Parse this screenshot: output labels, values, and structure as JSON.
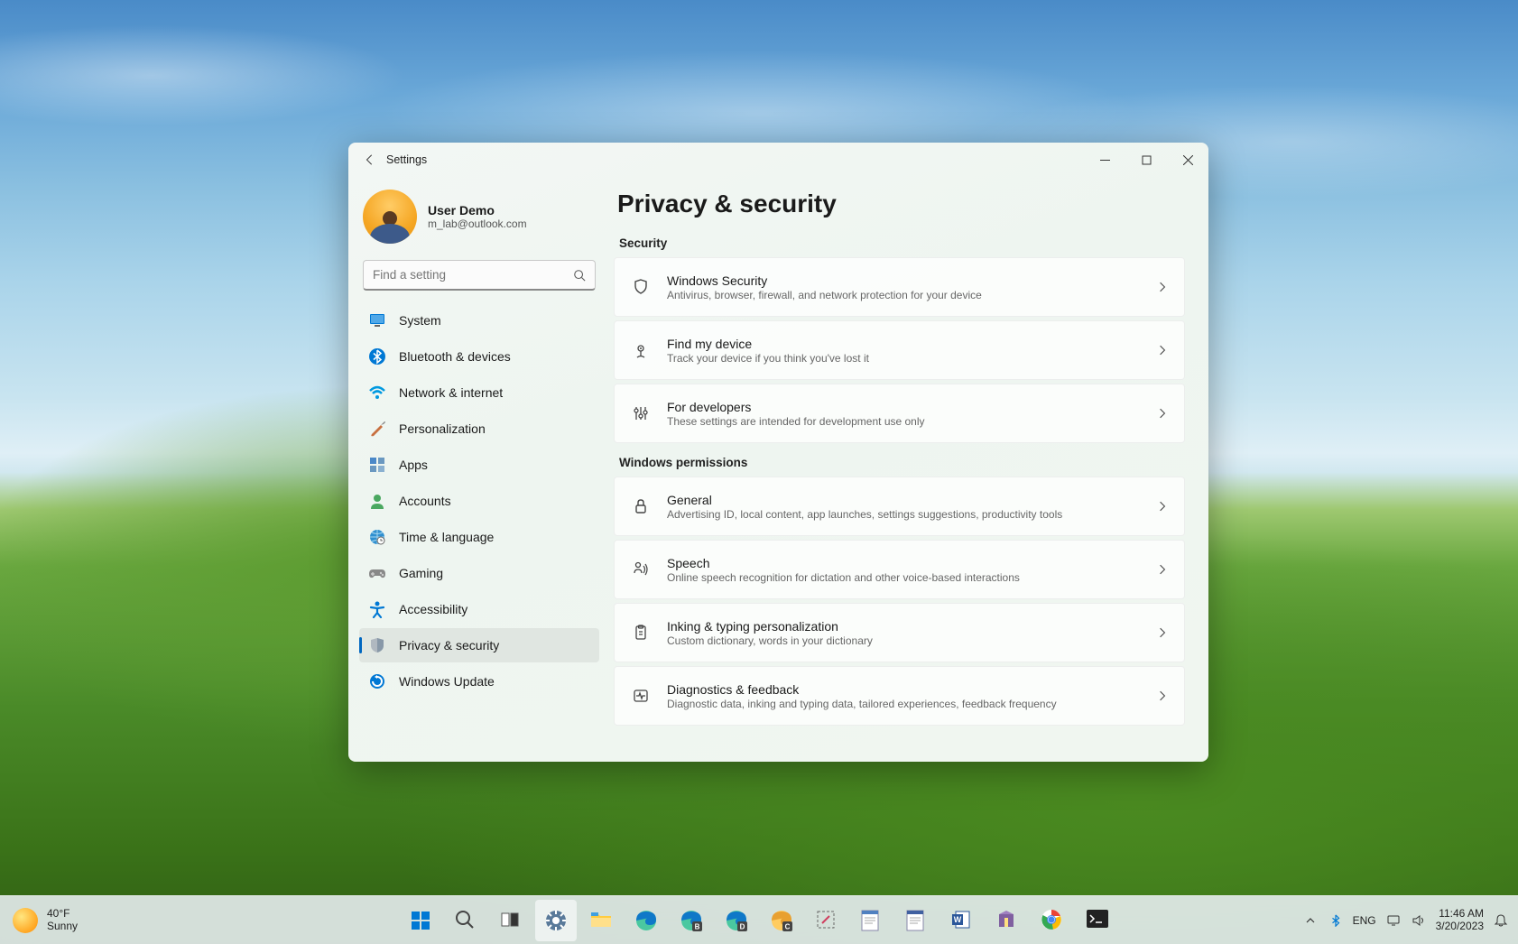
{
  "window": {
    "title": "Settings",
    "user": {
      "name": "User Demo",
      "email": "m_lab@outlook.com"
    },
    "search": {
      "placeholder": "Find a setting"
    }
  },
  "sidebar": {
    "items": [
      {
        "label": "System",
        "selected": false,
        "icon": "system"
      },
      {
        "label": "Bluetooth & devices",
        "selected": false,
        "icon": "bluetooth"
      },
      {
        "label": "Network & internet",
        "selected": false,
        "icon": "wifi"
      },
      {
        "label": "Personalization",
        "selected": false,
        "icon": "brush"
      },
      {
        "label": "Apps",
        "selected": false,
        "icon": "apps"
      },
      {
        "label": "Accounts",
        "selected": false,
        "icon": "person"
      },
      {
        "label": "Time & language",
        "selected": false,
        "icon": "globe"
      },
      {
        "label": "Gaming",
        "selected": false,
        "icon": "gamepad"
      },
      {
        "label": "Accessibility",
        "selected": false,
        "icon": "accessibility"
      },
      {
        "label": "Privacy & security",
        "selected": true,
        "icon": "shield"
      },
      {
        "label": "Windows Update",
        "selected": false,
        "icon": "update"
      }
    ]
  },
  "main": {
    "title": "Privacy & security",
    "sections": [
      {
        "header": "Security",
        "cards": [
          {
            "icon": "shield-outline",
            "title": "Windows Security",
            "desc": "Antivirus, browser, firewall, and network protection for your device"
          },
          {
            "icon": "location-pin",
            "title": "Find my device",
            "desc": "Track your device if you think you've lost it"
          },
          {
            "icon": "sliders",
            "title": "For developers",
            "desc": "These settings are intended for development use only"
          }
        ]
      },
      {
        "header": "Windows permissions",
        "cards": [
          {
            "icon": "lock",
            "title": "General",
            "desc": "Advertising ID, local content, app launches, settings suggestions, productivity tools"
          },
          {
            "icon": "mic-person",
            "title": "Speech",
            "desc": "Online speech recognition for dictation and other voice-based interactions"
          },
          {
            "icon": "clipboard",
            "title": "Inking & typing personalization",
            "desc": "Custom dictionary, words in your dictionary"
          },
          {
            "icon": "heartbeat",
            "title": "Diagnostics & feedback",
            "desc": "Diagnostic data, inking and typing data, tailored experiences, feedback frequency"
          }
        ]
      }
    ]
  },
  "taskbar": {
    "weather": {
      "temp": "40°F",
      "cond": "Sunny"
    },
    "apps": [
      {
        "name": "start",
        "active": false
      },
      {
        "name": "search",
        "active": false
      },
      {
        "name": "task-view",
        "active": false
      },
      {
        "name": "settings",
        "active": true
      },
      {
        "name": "file-explorer",
        "active": false
      },
      {
        "name": "edge",
        "active": false
      },
      {
        "name": "edge-beta",
        "active": false
      },
      {
        "name": "edge-dev",
        "active": false
      },
      {
        "name": "edge-canary",
        "active": false
      },
      {
        "name": "snipping-tool",
        "active": false
      },
      {
        "name": "notepad",
        "active": false
      },
      {
        "name": "notepad-alt",
        "active": false
      },
      {
        "name": "word",
        "active": false
      },
      {
        "name": "winrar",
        "active": false
      },
      {
        "name": "chrome",
        "active": false
      },
      {
        "name": "terminal",
        "active": false
      }
    ],
    "tray": {
      "lang": "ENG",
      "time": "11:46 AM",
      "date": "3/20/2023"
    }
  }
}
